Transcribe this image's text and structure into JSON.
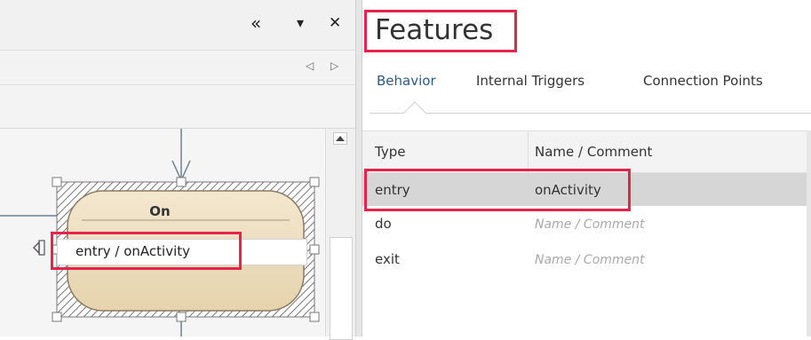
{
  "left": {
    "toolbar": {
      "collapse_icon": "«",
      "menu_icon": "▾",
      "close_icon": "✕"
    },
    "nav": {
      "prev_icon": "◁",
      "next_icon": "▷"
    },
    "state": {
      "name": "On",
      "entry_text": "entry / onActivity"
    }
  },
  "features": {
    "title": "Features",
    "tabs": [
      {
        "label": "Behavior",
        "active": true
      },
      {
        "label": "Internal Triggers"
      },
      {
        "label": "Connection Points"
      }
    ],
    "columns": [
      "Type",
      "Name / Comment"
    ],
    "rows": [
      {
        "type": "entry",
        "name": "onActivity",
        "selected": true
      },
      {
        "type": "do",
        "name": "Name / Comment",
        "placeholder": true
      },
      {
        "type": "exit",
        "name": "Name / Comment",
        "placeholder": true
      }
    ]
  },
  "colors": {
    "highlight": "#e8234b",
    "active_tab": "#2b5a8e",
    "selected_row": "#d6d6d6"
  }
}
